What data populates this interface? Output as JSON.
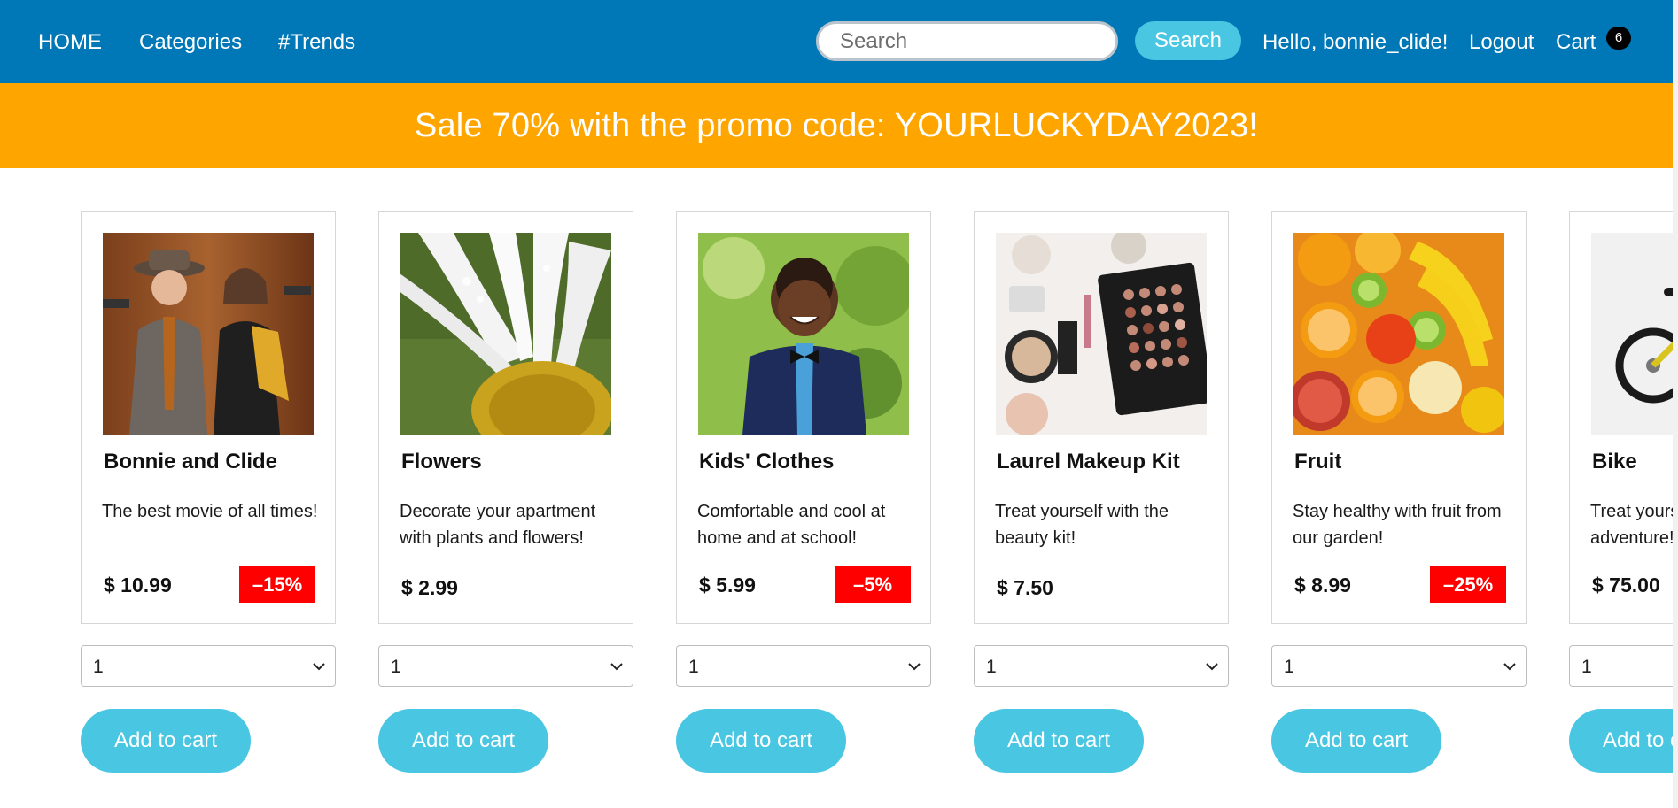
{
  "nav": {
    "home": "HOME",
    "categories": "Categories",
    "trends": "#Trends",
    "search_placeholder": "Search",
    "search_button": "Search",
    "greeting": "Hello, bonnie_clide!",
    "logout": "Logout",
    "cart": "Cart",
    "cart_count": "6"
  },
  "promo": {
    "text": "Sale 70% with the promo code: YOURLUCKYDAY2023!"
  },
  "colors": {
    "nav_bg": "#0077b6",
    "accent": "#48c6e2",
    "promo_bg": "#ffa500",
    "discount_bg": "#ff0000"
  },
  "products": [
    {
      "title": "Bonnie and Clide",
      "desc": "The best movie of all times!",
      "price": "$ 10.99",
      "discount": "–15%",
      "qty": "1",
      "add_label": "Add to cart",
      "image": "movie-poster-image"
    },
    {
      "title": "Flowers",
      "desc": "Decorate your apartment with plants and flowers!",
      "price": "$ 2.99",
      "discount": "",
      "qty": "1",
      "add_label": "Add to cart",
      "image": "daisy-flower-image"
    },
    {
      "title": "Kids' Clothes",
      "desc": "Comfortable and cool at home and at school!",
      "price": "$ 5.99",
      "discount": "–5%",
      "qty": "1",
      "add_label": "Add to cart",
      "image": "smiling-kid-image"
    },
    {
      "title": "Laurel Makeup Kit",
      "desc": "Treat yourself with the beauty kit!",
      "price": "$ 7.50",
      "discount": "",
      "qty": "1",
      "add_label": "Add to cart",
      "image": "makeup-kit-image"
    },
    {
      "title": "Fruit",
      "desc": "Stay healthy with fruit from our garden!",
      "price": "$ 8.99",
      "discount": "–25%",
      "qty": "1",
      "add_label": "Add to cart",
      "image": "fruit-image"
    },
    {
      "title": "Bike",
      "desc": "Treat yourself to an adventure!",
      "price": "$ 75.00",
      "discount": "",
      "qty": "1",
      "add_label": "Add to cart",
      "image": "bike-image"
    }
  ]
}
